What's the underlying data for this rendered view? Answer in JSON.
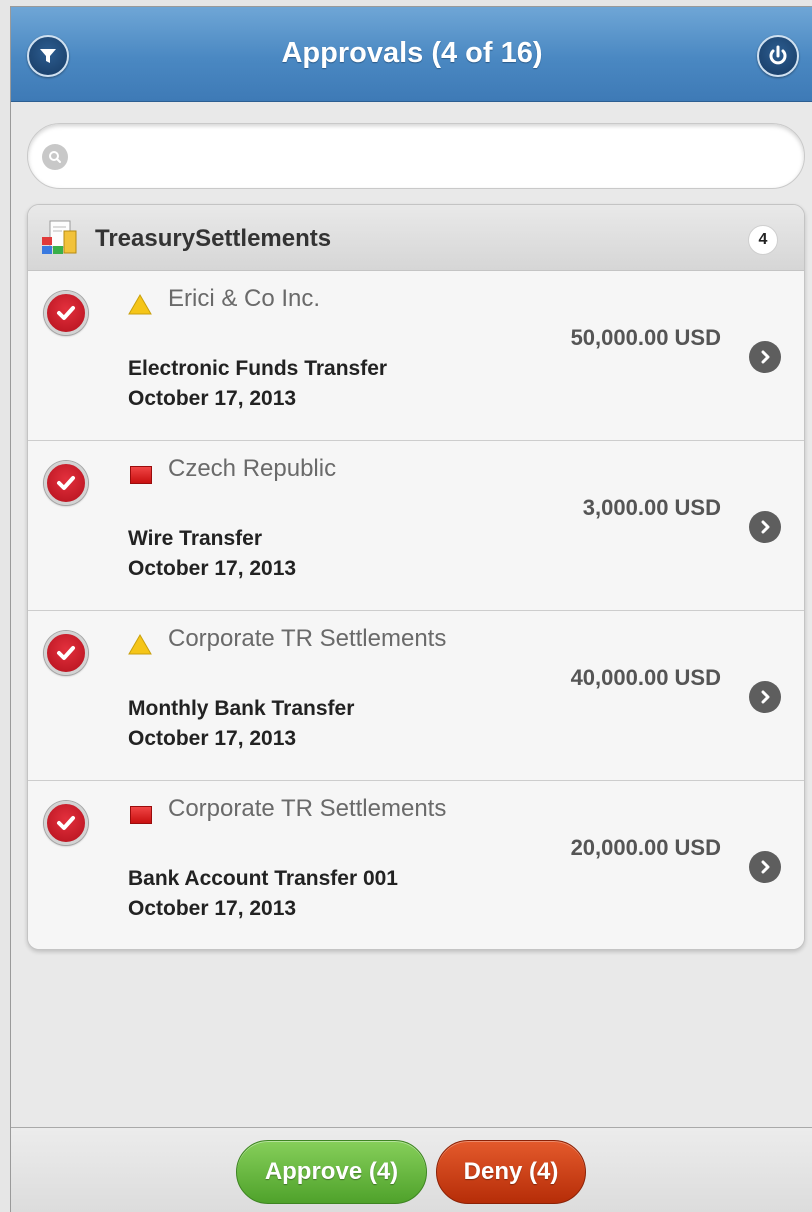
{
  "header": {
    "title": "Approvals (4 of 16)",
    "left_icon": "filter-icon",
    "right_icon": "power-icon"
  },
  "search": {
    "placeholder": "",
    "value": "",
    "icon": "search-icon"
  },
  "group": {
    "title": "TreasurySettlements",
    "count": "4",
    "icon": "treasury-app-icon"
  },
  "items": [
    {
      "title": "Erici & Co Inc.",
      "flag": "warning-triangle-icon",
      "amount": "50,000.00 USD",
      "type": "Electronic Funds Transfer",
      "date": "October 17, 2013",
      "selected": true
    },
    {
      "title": "Czech Republic",
      "flag": "red-square-icon",
      "amount": "3,000.00 USD",
      "type": "Wire Transfer",
      "date": "October 17, 2013",
      "selected": true
    },
    {
      "title": "Corporate TR Settlements",
      "flag": "warning-triangle-icon",
      "amount": "40,000.00 USD",
      "type": "Monthly Bank Transfer",
      "date": "October 17, 2013",
      "selected": true
    },
    {
      "title": "Corporate TR Settlements",
      "flag": "red-square-icon",
      "amount": "20,000.00 USD",
      "type": "Bank Account Transfer 001",
      "date": "October 17, 2013",
      "selected": true
    }
  ],
  "footer": {
    "approve_label": "Approve (4)",
    "deny_label": "Deny (4)"
  },
  "colors": {
    "header": "#4a88c2",
    "approve": "#5fb536",
    "deny": "#c8400f",
    "check": "#d41f2b"
  }
}
